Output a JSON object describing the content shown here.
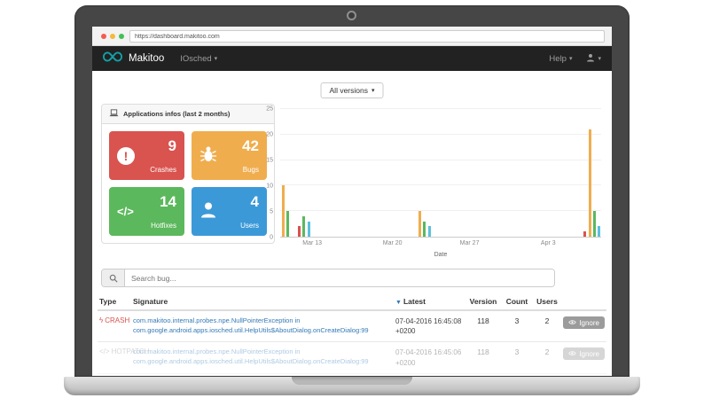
{
  "browser": {
    "url": "https://dashboard.makitoo.com"
  },
  "icons": {
    "caret_down": "▾",
    "sort_desc": "▼",
    "crash": "ϟ",
    "hotpatch": "</>",
    "exclamation": "!",
    "code": "</>"
  },
  "navbar": {
    "brand": "Makitoo",
    "project_menu": "IOsched",
    "help_menu": "Help"
  },
  "filters": {
    "versions_button": "All versions"
  },
  "stats_panel": {
    "title": "Applications infos (last 2 months)",
    "cards": [
      {
        "value": "9",
        "label": "Crashes",
        "color": "#d9534f"
      },
      {
        "value": "42",
        "label": "Bugs",
        "color": "#f0ad4e"
      },
      {
        "value": "14",
        "label": "Hotfixes",
        "color": "#5cb85c"
      },
      {
        "value": "4",
        "label": "Users",
        "color": "#3b99d8"
      }
    ]
  },
  "chart_data": {
    "type": "bar",
    "title": "",
    "xlabel": "Date",
    "ylabel": "",
    "ylim": [
      0,
      25
    ],
    "yticks": [
      0,
      5,
      10,
      15,
      20,
      25
    ],
    "xticks": [
      {
        "label": "Mar 13",
        "pct": 10
      },
      {
        "label": "Mar 20",
        "pct": 35
      },
      {
        "label": "Mar 27",
        "pct": 59
      },
      {
        "label": "Apr 3",
        "pct": 83.5
      }
    ],
    "bars": [
      {
        "x_pct": 0.5,
        "value": 10,
        "color": "#f0ad4e"
      },
      {
        "x_pct": 2,
        "value": 5,
        "color": "#5cb85c"
      },
      {
        "x_pct": 5.5,
        "value": 2,
        "color": "#d9534f"
      },
      {
        "x_pct": 7,
        "value": 4,
        "color": "#5cb85c"
      },
      {
        "x_pct": 8.5,
        "value": 3,
        "color": "#5bc0de"
      },
      {
        "x_pct": 43,
        "value": 5,
        "color": "#f0ad4e"
      },
      {
        "x_pct": 44.5,
        "value": 3,
        "color": "#5cb85c"
      },
      {
        "x_pct": 46,
        "value": 2,
        "color": "#5bc0de"
      },
      {
        "x_pct": 94.5,
        "value": 1,
        "color": "#d9534f"
      },
      {
        "x_pct": 96,
        "value": 21,
        "color": "#f0ad4e"
      },
      {
        "x_pct": 97.5,
        "value": 5,
        "color": "#5cb85c"
      },
      {
        "x_pct": 99,
        "value": 2,
        "color": "#5bc0de"
      }
    ]
  },
  "search": {
    "placeholder": "Search bug..."
  },
  "bug_table": {
    "headers": {
      "type": "Type",
      "signature": "Signature",
      "latest": "Latest",
      "version": "Version",
      "count": "Count",
      "users": "Users"
    },
    "rows": [
      {
        "type": "CRASH",
        "signature": "com.makitoo.internal.probes.npe.NullPointerException in com.google.android.apps.iosched.util.HelpUtils$AboutDialog.onCreateDialog:99",
        "latest": "07-04-2016 16:45:08 +0200",
        "version": "118",
        "count": "3",
        "users": "2",
        "action": "Ignore"
      },
      {
        "type": "HOTPATCH",
        "signature": "com.makitoo.internal.probes.npe.NullPointerException in com.google.android.apps.iosched.util.HelpUtils$AboutDialog.onCreateDialog:99",
        "latest": "07-04-2016 16:45:06 +0200",
        "version": "118",
        "count": "3",
        "users": "2",
        "action": "Ignore"
      }
    ]
  }
}
